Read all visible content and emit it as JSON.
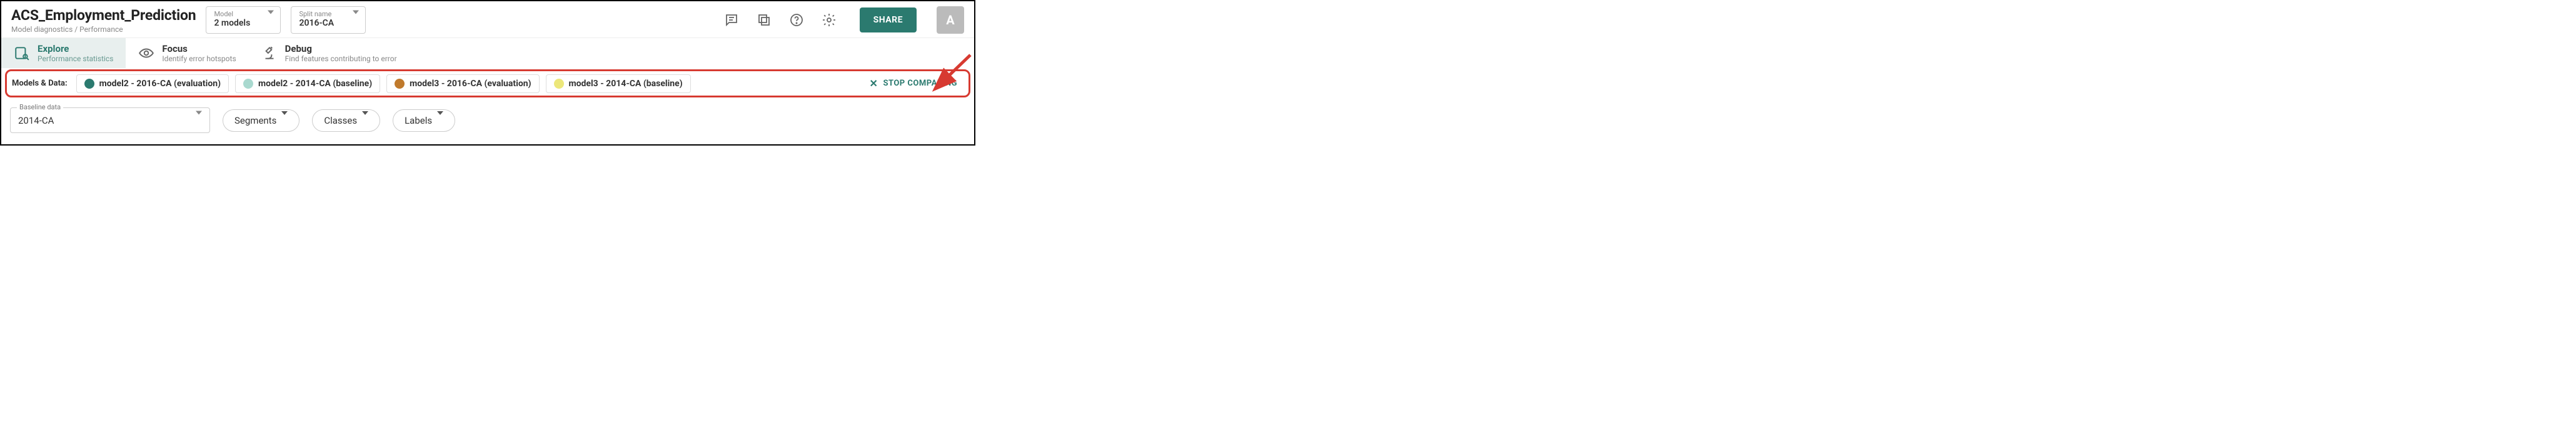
{
  "header": {
    "title": "ACS_Employment_Prediction",
    "breadcrumb": "Model diagnostics / Performance",
    "model_dd": {
      "label": "Model",
      "value": "2 models"
    },
    "split_dd": {
      "label": "Split name",
      "value": "2016-CA"
    },
    "share_label": "SHARE",
    "avatar_initial": "A"
  },
  "tabs": {
    "explore": {
      "title": "Explore",
      "sub": "Performance statistics"
    },
    "focus": {
      "title": "Focus",
      "sub": "Identify error hotspots"
    },
    "debug": {
      "title": "Debug",
      "sub": "Find features contributing to error"
    }
  },
  "models_bar": {
    "label": "Models & Data:",
    "chips": [
      {
        "label": "model2 - 2016-CA (evaluation)",
        "color": "#2b7a6f"
      },
      {
        "label": "model2 - 2014-CA (baseline)",
        "color": "#a9d9cf"
      },
      {
        "label": "model3 - 2016-CA (evaluation)",
        "color": "#c07a2c"
      },
      {
        "label": "model3 - 2014-CA (baseline)",
        "color": "#ece77a"
      }
    ],
    "stop_label": "STOP COMPARING"
  },
  "filters": {
    "baseline": {
      "legend": "Baseline data",
      "value": "2014-CA"
    },
    "segments_label": "Segments",
    "classes_label": "Classes",
    "labels_label": "Labels"
  }
}
